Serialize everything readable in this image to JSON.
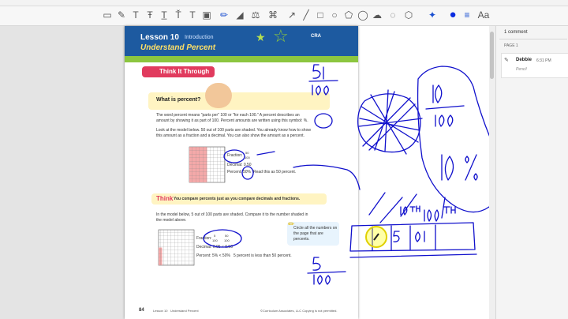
{
  "toolbar": {
    "aa_label": "Aa"
  },
  "document": {
    "lesson_number": "Lesson 10",
    "intro_tag": "Introduction",
    "lesson_title": "Understand Percent",
    "badge": "CRA",
    "think_banner": "Think It Through",
    "question_title": "What is percent?",
    "para1_line1": "The word percent means \"parts per\" 100 or \"for each 100.\" A percent describes an",
    "para1_line2": "amount by showing it as part of 100. Percent amounts are written using this symbol: %.",
    "para2_line1": "Look at the model below. 50 out of 100 parts are shaded. You already know how to show",
    "para2_line2": "this amount as a fraction and a decimal. You can also show the amount as a percent.",
    "fraction1_label": "Fraction:",
    "fraction1_num": "50",
    "fraction1_den": "100",
    "decimal1": "Decimal: 0.50",
    "percent1_label": "Percent:",
    "percent1_val": "50%",
    "percent1_note": "Read this as 50 percent.",
    "think_label": "Think",
    "think_text": "You compare percents just as you compare decimals and fractions.",
    "para3_line1": "In the model below, 5 out of 100 parts are shaded. Compare it to the number shaded in",
    "para3_line2": "the model above.",
    "fraction2_label": "Fraction:",
    "fraction2_a": "5",
    "fraction2_b": "100",
    "fraction2_c": "50",
    "fraction2_d": "100",
    "decimal2": "Decimal: 0.05 < 0.50",
    "percent2": "Percent: 5% < 50%",
    "percent2_note": "5 percent is less than 50 percent.",
    "callout_text": "Circle all the numbers on the page that are percents.",
    "footer_page": "84",
    "footer_lesson": "Lesson 10",
    "footer_sub": "Understand Percent",
    "footer_copy": "©Curriculum Associates, LLC   Copying is not permitted."
  },
  "comments_panel": {
    "count": "1 comment",
    "page_label": "PAGE 1",
    "author": "Debbie",
    "time": "6:31 PM",
    "type": "Pencil"
  },
  "colors": {
    "ink": "#1010cc",
    "header": "#1d5aa0",
    "banner": "#e13b5e",
    "highlight": "#ffff00"
  }
}
